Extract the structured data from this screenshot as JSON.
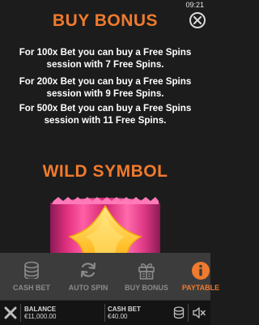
{
  "status": {
    "time": "09:21"
  },
  "paytable": {
    "buy_bonus_title": "BUY BONUS",
    "buy_bonus_lines": [
      "For 100x Bet you can buy a Free Spins session with 7 Free Spins.",
      "For 200x Bet you can buy a Free Spins session with 9 Free Spins.",
      "For 500x Bet you can buy a Free Spins session with 11 Free Spins."
    ],
    "wild_symbol_title": "WILD SYMBOL"
  },
  "tabs": [
    {
      "label": "CASH BET",
      "icon": "coins-icon"
    },
    {
      "label": "AUTO SPIN",
      "icon": "refresh-icon"
    },
    {
      "label": "BUY BONUS",
      "icon": "gift-icon"
    },
    {
      "label": "PAYTABLE",
      "icon": "info-icon",
      "active": true
    }
  ],
  "footer": {
    "balance_label": "BALANCE",
    "balance_value": "€11,000.00",
    "cash_bet_label": "CASH BET",
    "cash_bet_value": "€40.00"
  },
  "colors": {
    "accent": "#f07a2d",
    "background": "#1c1c1c",
    "tabbar": "#3c3c3c",
    "footer": "#141414"
  }
}
